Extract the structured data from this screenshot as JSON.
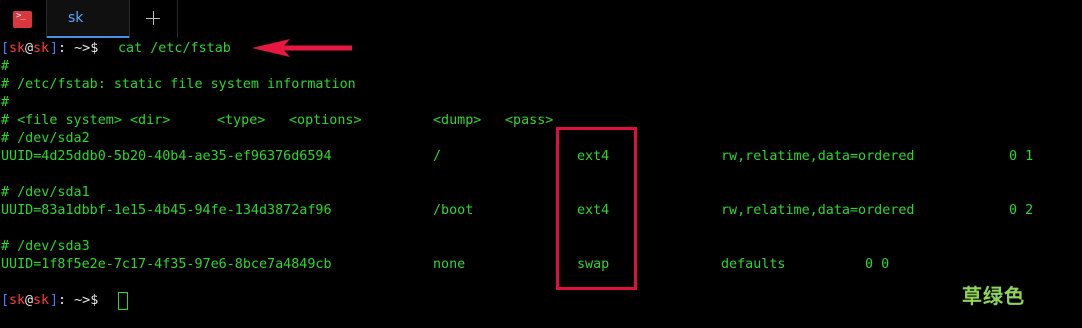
{
  "tabs": {
    "app_icon_glyph": ">_",
    "active_tab_label": "sk"
  },
  "prompt": {
    "open_bracket": "[",
    "user": "sk",
    "at": "@",
    "host": "sk",
    "close_bracket": "]",
    "suffix": ": ~>$ "
  },
  "command": "cat /etc/fstab",
  "fstab": {
    "comment_blank_1": "#",
    "comment_header": "# /etc/fstab: static file system information",
    "comment_blank_2": "#",
    "column_header": {
      "file_system": "# <file system> <dir>",
      "type": "<type>",
      "options": "<options>",
      "dump": "<dump>",
      "pass": "<pass>"
    },
    "entries": [
      {
        "comment": "# /dev/sda2",
        "uuid": "UUID=4d25ddb0-5b20-40b4-ae35-ef96376d6594",
        "dir": "/",
        "type": "ext4",
        "options": "rw,relatime,data=ordered",
        "dump_pass": "0 1"
      },
      {
        "comment": "# /dev/sda1",
        "uuid": "UUID=83a1dbbf-1e15-4b45-94fe-134d3872af96",
        "dir": "/boot",
        "type": "ext4",
        "options": "rw,relatime,data=ordered",
        "dump_pass": "0 2"
      },
      {
        "comment": "# /dev/sda3",
        "uuid": "UUID=1f8f5e2e-7c17-4f35-97e6-8bce7a4849cb",
        "dir": "none",
        "type": "swap",
        "options": "defaults",
        "dump_pass": "0 0"
      }
    ]
  },
  "annotation": {
    "arrow_color": "#e8173f",
    "box_color": "#e0103a"
  },
  "watermark": "草绿色",
  "colors": {
    "terminal_bg": "#000000",
    "text_green": "#2bd72b",
    "prompt_blue": "#4d7cff",
    "prompt_red": "#ff3b3b",
    "tab_active_blue": "#5aa9ff"
  }
}
